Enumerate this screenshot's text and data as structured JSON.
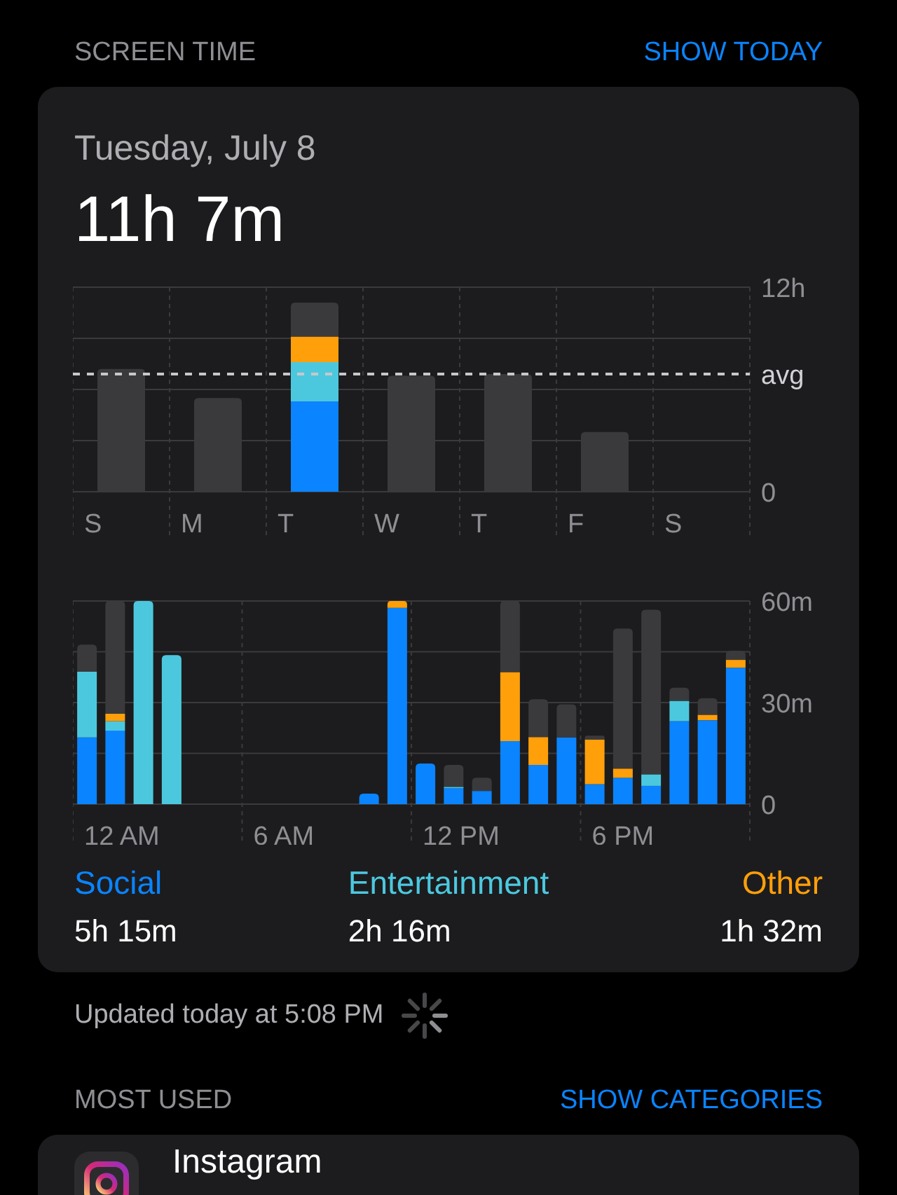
{
  "header": {
    "title": "SCREEN TIME",
    "action": "SHOW TODAY"
  },
  "summary": {
    "date": "Tuesday, July 8",
    "total": "11h 7m"
  },
  "weekly": {
    "chart_data": {
      "type": "bar",
      "stacked": true,
      "categories": [
        "S",
        "M",
        "T",
        "W",
        "T",
        "F",
        "S"
      ],
      "ylim": [
        0,
        12
      ],
      "yticks": [
        {
          "value": 0,
          "label": "0"
        },
        {
          "value": 12,
          "label": "12h"
        }
      ],
      "series": [
        {
          "color": "#0a84ff",
          "values": [
            0,
            0,
            5.3,
            0,
            0,
            0,
            null
          ]
        },
        {
          "color": "#4cc8de",
          "values": [
            0,
            0,
            2.3,
            0,
            0,
            0,
            null
          ]
        },
        {
          "color": "#ff9f0a",
          "values": [
            0,
            0,
            1.5,
            0,
            0,
            0,
            null
          ]
        },
        {
          "color": "#3a3a3c",
          "values": [
            7.2,
            5.5,
            2,
            6.8,
            6.9,
            3.5,
            null
          ]
        }
      ],
      "ref_lines": [
        {
          "axis": "y",
          "value": 6.9,
          "label": "avg"
        }
      ]
    }
  },
  "hourly": {
    "hour_labels": [
      "12 AM",
      "6 AM",
      "12 PM",
      "6 PM"
    ],
    "chart_data": {
      "type": "bar",
      "stacked": true,
      "categories": [
        null,
        null,
        null,
        null,
        null,
        null,
        null,
        null,
        null,
        null,
        null,
        null,
        null,
        null,
        null,
        null,
        null,
        null,
        null,
        null,
        null,
        null,
        null,
        null
      ],
      "ylim": [
        0,
        60
      ],
      "yticks": [
        {
          "value": 0,
          "label": "0"
        },
        {
          "value": 30,
          "label": "30m"
        },
        {
          "value": 60,
          "label": "60m"
        }
      ],
      "series": [
        {
          "color": "#0a84ff",
          "values": [
            19.7,
            21.7,
            0,
            0,
            0,
            0,
            0,
            0,
            0,
            0,
            3.1,
            58,
            12,
            4.7,
            3.9,
            18.6,
            11.6,
            19.7,
            5.9,
            7.8,
            5.4,
            24.5,
            24.8,
            40.3
          ]
        },
        {
          "color": "#4cc8de",
          "values": [
            19.4,
            2.8,
            60,
            44,
            0,
            0,
            0,
            0,
            0,
            0,
            0,
            0,
            0,
            0.4,
            0,
            0,
            0,
            0,
            0,
            0,
            3.4,
            6,
            0,
            0
          ]
        },
        {
          "color": "#ff9f0a",
          "values": [
            0,
            2.2,
            0,
            0,
            0,
            0,
            0,
            0,
            0,
            0,
            0,
            2,
            0,
            0,
            0,
            20.4,
            8.2,
            0,
            13.2,
            2.7,
            0,
            0,
            1.6,
            2.3
          ]
        },
        {
          "color": "#3a3a3c",
          "values": [
            8,
            33.3,
            0,
            0,
            0,
            0,
            0,
            0,
            0,
            0,
            null,
            0,
            null,
            6.5,
            3.9,
            21,
            11.2,
            9.8,
            1.1,
            41.4,
            48.6,
            3.9,
            4.9,
            2.7
          ]
        }
      ]
    }
  },
  "legend": [
    {
      "label": "Social",
      "value": "5h 15m",
      "color": "#0a84ff"
    },
    {
      "label": "Entertainment",
      "value": "2h 16m",
      "color": "#4cc8de"
    },
    {
      "label": "Other",
      "value": "1h 32m",
      "color": "#ff9f0a"
    }
  ],
  "updated": "Updated today at 5:08 PM",
  "most_used": {
    "title": "MOST USED",
    "action": "SHOW CATEGORIES",
    "apps": [
      {
        "name": "Instagram"
      }
    ]
  }
}
